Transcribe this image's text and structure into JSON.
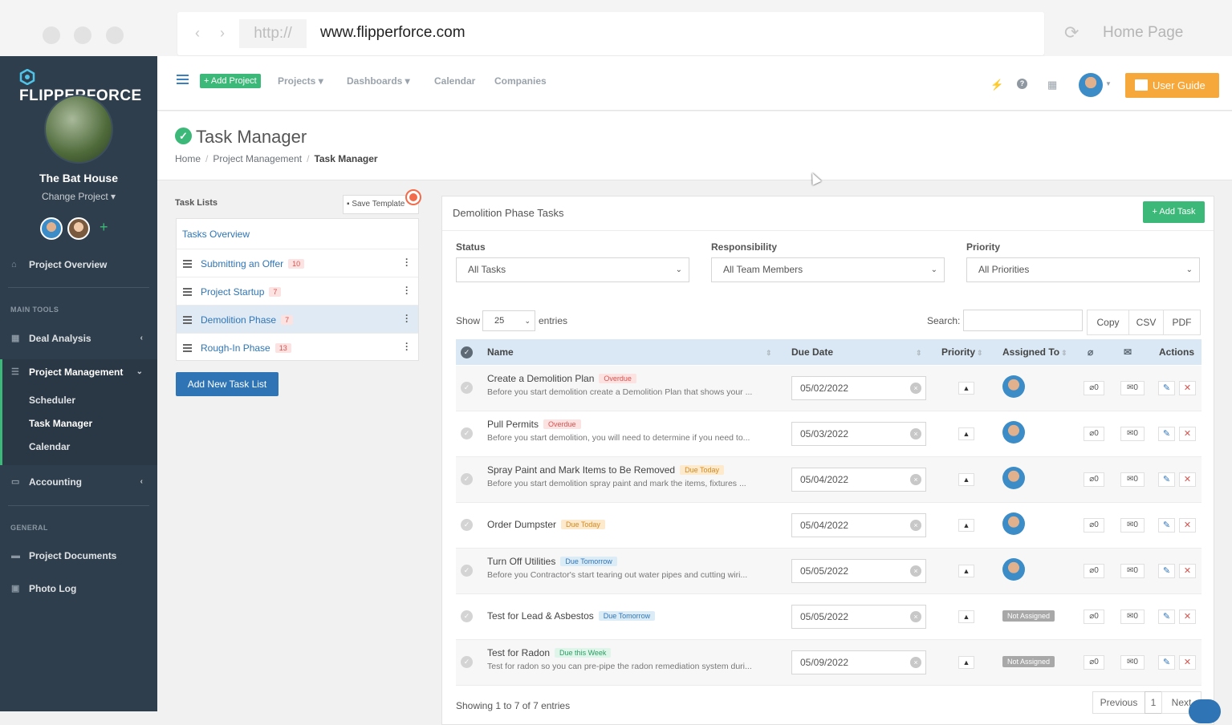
{
  "browser": {
    "protocol": "http://",
    "url": "www.flipperforce.com",
    "home_label": "Home Page"
  },
  "sidebar": {
    "brand": "FLIPPERFORCE",
    "project_name": "The Bat House",
    "change_project": "Change Project ▾",
    "overview": "Project Overview",
    "main_tools_heading": "MAIN TOOLS",
    "deal_analysis": "Deal Analysis",
    "project_management": "Project Management",
    "sub_items": [
      "Scheduler",
      "Task Manager",
      "Calendar"
    ],
    "accounting": "Accounting",
    "general_heading": "GENERAL",
    "project_documents": "Project Documents",
    "photo_log": "Photo Log"
  },
  "topnav": {
    "add_project": "+ Add Project",
    "links": [
      "Projects ▾",
      "Dashboards ▾",
      "Calendar",
      "Companies"
    ],
    "user_guide": "User Guide",
    "icons": [
      "menu-icon",
      "bolt-icon",
      "help-icon",
      "gift-icon"
    ]
  },
  "header": {
    "title": "Task Manager",
    "breadcrumb": [
      "Home",
      "Project Management",
      "Task Manager"
    ]
  },
  "task_lists": {
    "title": "Task Lists",
    "save_template": "Save Template",
    "overview": "Tasks Overview",
    "items": [
      {
        "label": "Submitting an Offer",
        "count": "10"
      },
      {
        "label": "Project Startup",
        "count": "7"
      },
      {
        "label": "Demolition Phase",
        "count": "7"
      },
      {
        "label": "Rough-In Phase",
        "count": "13"
      }
    ],
    "add_button": "Add New Task List"
  },
  "panel": {
    "title": "Demolition Phase Tasks",
    "add_task": "+ Add Task",
    "filters": {
      "status_label": "Status",
      "status_value": "All Tasks",
      "responsibility_label": "Responsibility",
      "responsibility_value": "All Team Members",
      "priority_label": "Priority",
      "priority_value": "All Priorities"
    },
    "show_label": "Show",
    "entries_value": "25",
    "entries_label": "entries",
    "search_label": "Search:",
    "export": [
      "Copy",
      "CSV",
      "PDF"
    ],
    "columns": [
      "Name",
      "Due Date",
      "Priority",
      "Assigned To",
      "Actions"
    ],
    "rows": [
      {
        "name": "Create a Demolition Plan",
        "tag": "Overdue",
        "tag_type": "overdue",
        "desc": "Before you start demolition create a Demolition Plan that shows your ...",
        "due": "05/02/2022",
        "assigned": "avatar",
        "attachments": "0",
        "comments": "0"
      },
      {
        "name": "Pull Permits",
        "tag": "Overdue",
        "tag_type": "overdue",
        "desc": "Before you start demolition, you will need to determine if you need to...",
        "due": "05/03/2022",
        "assigned": "avatar",
        "attachments": "0",
        "comments": "0"
      },
      {
        "name": "Spray Paint and Mark Items to Be Removed",
        "tag": "Due Today",
        "tag_type": "today",
        "desc": "Before you start demolition spray paint and mark the items, fixtures ...",
        "due": "05/04/2022",
        "assigned": "avatar",
        "attachments": "0",
        "comments": "0"
      },
      {
        "name": "Order Dumpster",
        "tag": "Due Today",
        "tag_type": "today",
        "desc": "",
        "due": "05/04/2022",
        "assigned": "avatar",
        "attachments": "0",
        "comments": "0"
      },
      {
        "name": "Turn Off Utilities",
        "tag": "Due Tomorrow",
        "tag_type": "tomorrow",
        "desc": "Before you Contractor's start tearing out water pipes and cutting wiri...",
        "due": "05/05/2022",
        "assigned": "avatar",
        "attachments": "0",
        "comments": "0"
      },
      {
        "name": "Test for Lead & Asbestos",
        "tag": "Due Tomorrow",
        "tag_type": "tomorrow",
        "desc": "",
        "due": "05/05/2022",
        "assigned": "Not Assigned",
        "attachments": "0",
        "comments": "0"
      },
      {
        "name": "Test for Radon",
        "tag": "Due this Week",
        "tag_type": "week",
        "desc": "Test for radon so you can pre-pipe the radon remediation system duri...",
        "due": "05/09/2022",
        "assigned": "Not Assigned",
        "attachments": "0",
        "comments": "0"
      }
    ],
    "showing": "Showing 1 to 7 of 7 entries",
    "pager": [
      "Previous",
      "1",
      "Next"
    ]
  }
}
